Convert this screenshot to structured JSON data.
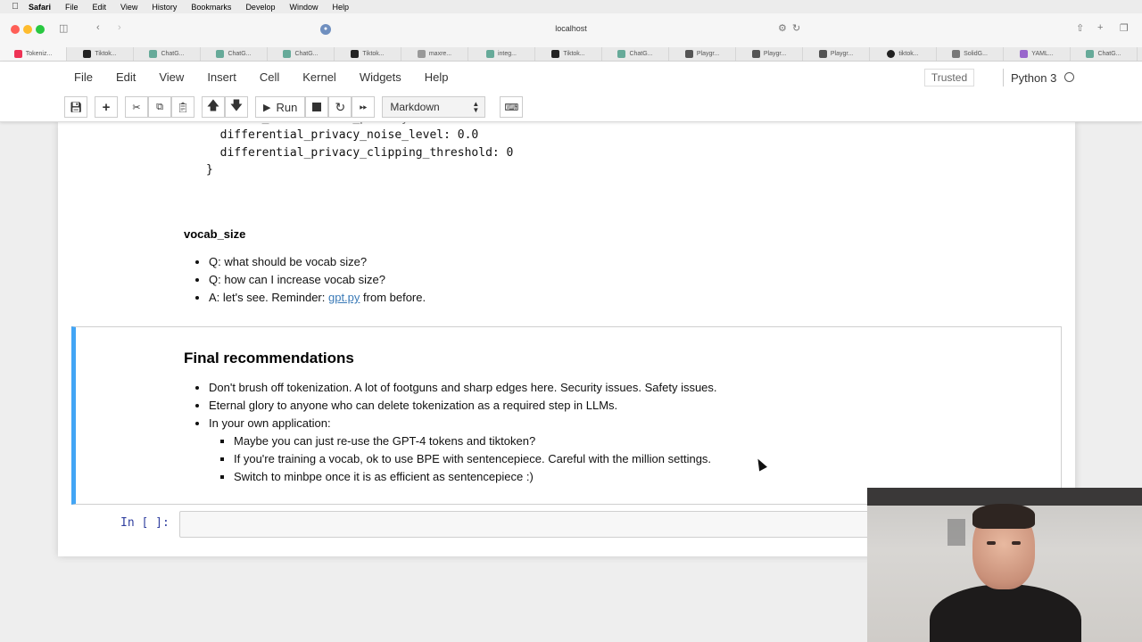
{
  "menubar": {
    "app": "Safari",
    "items": [
      "File",
      "Edit",
      "View",
      "History",
      "Bookmarks",
      "Develop",
      "Window",
      "Help"
    ]
  },
  "browser": {
    "url": "localhost"
  },
  "tabs": [
    "Tokeniz...",
    "Tiktok...",
    "ChatG...",
    "ChatG...",
    "ChatG...",
    "Tiktok...",
    "maxre...",
    "integ...",
    "Tiktok...",
    "ChatG...",
    "Playgr...",
    "Playgr...",
    "Playgr...",
    "tiktok...",
    "SolidG...",
    "YAML...",
    "ChatG..."
  ],
  "jupyter": {
    "menu": [
      "File",
      "Edit",
      "View",
      "Insert",
      "Cell",
      "Kernel",
      "Widgets",
      "Help"
    ],
    "trusted": "Trusted",
    "kernel": "Python 3",
    "run_label": "Run",
    "cell_type": "Markdown"
  },
  "code_lines": {
    "line0": "  enable_differential_privacy: false",
    "line1": "  differential_privacy_noise_level: 0.0",
    "line2": "  differential_privacy_clipping_threshold: 0",
    "line3": "}"
  },
  "vocab": {
    "heading": "vocab_size",
    "q1": "Q: what should be vocab size?",
    "q2": "Q: how can I increase vocab size?",
    "a_prefix": "A: let's see. Reminder: ",
    "a_link": "gpt.py",
    "a_suffix": " from before."
  },
  "final": {
    "heading": "Final recommendations",
    "b1": "Don't brush off tokenization. A lot of footguns and sharp edges here. Security issues. Safety issues.",
    "b2": "Eternal glory to anyone who can delete tokenization as a required step in LLMs.",
    "b3": "In your own application:",
    "s1": "Maybe you can just re-use the GPT-4 tokens and tiktoken?",
    "s2": "If you're training a vocab, ok to use BPE with sentencepiece. Careful with the million settings.",
    "s3": "Switch to minbpe once it is as efficient as sentencepiece :)"
  },
  "prompt": "In [ ]:"
}
